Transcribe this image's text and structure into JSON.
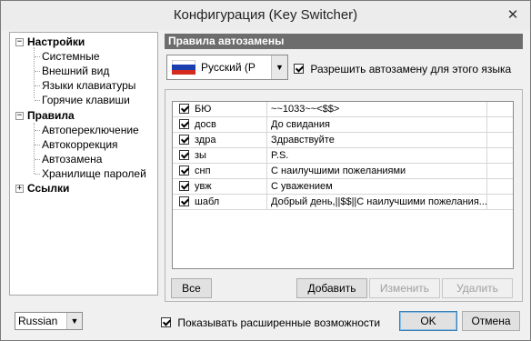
{
  "window": {
    "title": "Конфигурация (Key Switcher)",
    "close_glyph": "✕"
  },
  "tree": {
    "settings": {
      "label": "Настройки",
      "expander": "−",
      "children": [
        "Системные",
        "Внешний вид",
        "Языки клавиатуры",
        "Горячие клавиши"
      ]
    },
    "rules": {
      "label": "Правила",
      "expander": "−",
      "children": [
        "Автопереключение",
        "Автокоррекция",
        "Автозамена",
        "Хранилище паролей"
      ]
    },
    "links": {
      "label": "Ссылки",
      "expander": "+"
    }
  },
  "panel": {
    "header": "Правила автозамены",
    "language_combo": {
      "value": "Русский (Росси",
      "flag_colors": [
        "#ffffff",
        "#1c3fb0",
        "#d52b1e"
      ]
    },
    "allow_checkbox": {
      "label": "Разрешить автозамену для этого языка",
      "checked": true
    }
  },
  "rules_list": [
    {
      "checked": true,
      "abbr": "БЮ",
      "text": "~~1033~~<$$>"
    },
    {
      "checked": true,
      "abbr": "досв",
      "text": "До свидания"
    },
    {
      "checked": true,
      "abbr": "здра",
      "text": "Здравствуйте"
    },
    {
      "checked": true,
      "abbr": "зы",
      "text": "P.S."
    },
    {
      "checked": true,
      "abbr": "снп",
      "text": "С наилучшими пожеланиями"
    },
    {
      "checked": true,
      "abbr": "увж",
      "text": "С уважением"
    },
    {
      "checked": true,
      "abbr": "шабл",
      "text": "Добрый день,||$$||С наилучшими пожелания..."
    }
  ],
  "list_buttons": {
    "all": "Все",
    "add": "Добавить",
    "edit": "Изменить",
    "delete": "Удалить"
  },
  "footer": {
    "ui_language": "Russian",
    "advanced_checkbox": {
      "label": "Показывать расширенные возможности",
      "checked": true
    },
    "ok": "OK",
    "cancel": "Отмена"
  }
}
